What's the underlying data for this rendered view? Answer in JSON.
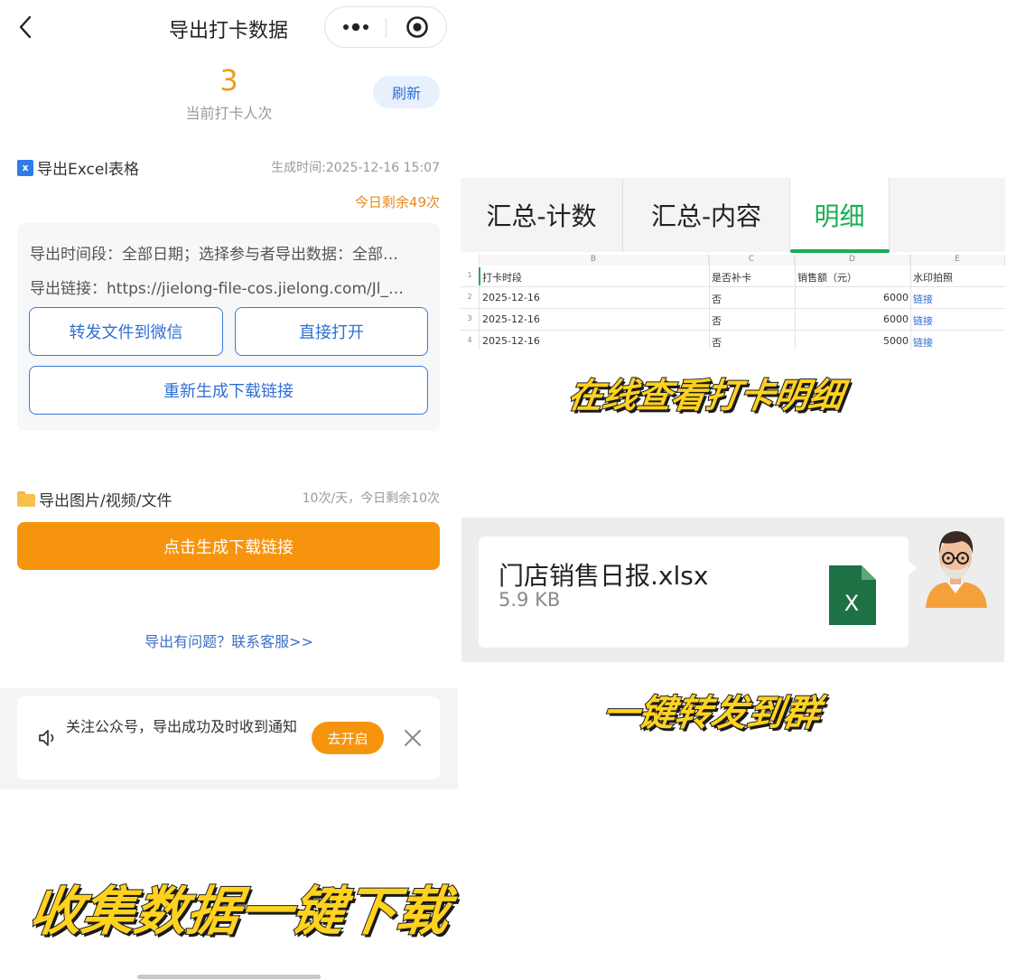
{
  "nav": {
    "title": "导出打卡数据"
  },
  "stats": {
    "count": "3",
    "count_label": "当前打卡人次",
    "refresh_label": "刷新"
  },
  "excel": {
    "title": "导出Excel表格",
    "generated": "生成时间:2025-12-16 15:07",
    "remain": "今日剩余49次",
    "line1": "导出时间段：全部日期；选择参与者导出数据：全部…",
    "line2": "导出链接：https://jielong-file-cos.jielong.com/Jl_…",
    "forward_label": "转发文件到微信",
    "open_label": "直接打开",
    "regen_label": "重新生成下载链接"
  },
  "media": {
    "title": "导出图片/视频/文件",
    "quota": "10次/天，今日剩余10次",
    "generate_label": "点击生成下载链接"
  },
  "help": {
    "text": "导出有问题？联系客服>>"
  },
  "notice": {
    "text": "关注公众号，导出成功及时收到通知",
    "button_label": "去开启"
  },
  "captions": {
    "left": "收集数据一键下载",
    "sheet": "在线查看打卡明细",
    "chat": "一键转发到群"
  },
  "sheet": {
    "tabs": [
      "汇总-计数",
      "汇总-内容",
      "明细"
    ],
    "active_tab": 2,
    "col_letters": [
      "B",
      "C",
      "D",
      "E"
    ],
    "headers": [
      "打卡时段",
      "是否补卡",
      "销售额（元）",
      "水印拍照"
    ],
    "rows": [
      {
        "num": "2",
        "date": "2025-12-16",
        "makeup": "否",
        "sales": "6000",
        "photo": "链接"
      },
      {
        "num": "3",
        "date": "2025-12-16",
        "makeup": "否",
        "sales": "6000",
        "photo": "链接"
      },
      {
        "num": "4",
        "date": "2025-12-16",
        "makeup": "否",
        "sales": "5000",
        "photo": "链接"
      }
    ],
    "header_row_num": "1",
    "accent": "#1aad53"
  },
  "chat_file": {
    "name": "门店销售日报.xlsx",
    "size": "5.9 KB",
    "icon_letter": "X"
  },
  "colors": {
    "orange": "#f7940d",
    "blue": "#2f6fd6",
    "caption_yellow": "#ffd21f"
  }
}
